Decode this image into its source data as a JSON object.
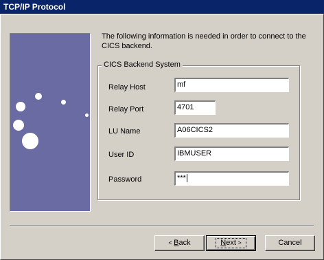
{
  "window": {
    "title": "TCP/IP Protocol"
  },
  "intro_text": "The following information is needed in order to connect to the CICS backend.",
  "group": {
    "title": "CICS Backend System",
    "fields": [
      {
        "label": "Relay Host",
        "value": "mf"
      },
      {
        "label": "Relay Port",
        "value": "4701"
      },
      {
        "label": "LU Name",
        "value": "A06CICS2"
      },
      {
        "label": "User ID",
        "value": "IBMUSER"
      },
      {
        "label": "Password",
        "value": "***"
      }
    ]
  },
  "buttons": {
    "back_prefix": "< ",
    "back_mnemonic": "B",
    "back_rest": "ack",
    "next_mnemonic": "N",
    "next_rest": "ext",
    "next_suffix": " >",
    "cancel": "Cancel"
  },
  "colors": {
    "title_bar": "#0a246a",
    "side_panel": "#6b6ba3",
    "dialog_background": "#d4d0c8"
  }
}
